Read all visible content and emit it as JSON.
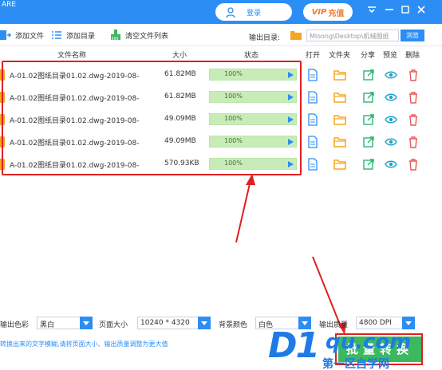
{
  "titlebar": {
    "app_mark": "ARE",
    "login_label": "登录",
    "vip_tag": "VIP",
    "vip_label": "充值",
    "menu_icon": "menu-dropdown-icon",
    "minimize_icon": "minimize-icon",
    "close_icon": "close-icon"
  },
  "toolbar": {
    "add_file": "添加文件",
    "add_dir": "添加目录",
    "clear_list": "清空文件列表",
    "output_dir_label": "输出目录:",
    "output_path": "Mloong\\Desktop\\机械图纸",
    "browse": "浏览"
  },
  "columns": {
    "name": "文件名称",
    "size": "大小",
    "status": "状态",
    "open": "打开",
    "folder": "文件夹",
    "share": "分享",
    "preview": "预览",
    "delete": "删除"
  },
  "files": [
    {
      "name": "A-01.02图纸目录01.02.dwg-2019-08-",
      "size": "61.82MB",
      "progress": "100%",
      "progress_value": 1.0
    },
    {
      "name": "A-01.02图纸目录01.02.dwg-2019-08-",
      "size": "61.82MB",
      "progress": "100%",
      "progress_value": 1.0
    },
    {
      "name": "A-01.02图纸目录01.02.dwg-2019-08-",
      "size": "49.09MB",
      "progress": "100%",
      "progress_value": 1.0
    },
    {
      "name": "A-01.02图纸目录01.02.dwg-2019-08-",
      "size": "49.09MB",
      "progress": "100%",
      "progress_value": 1.0
    },
    {
      "name": "A-01.02图纸目录01.02.dwg-2019-08-",
      "size": "570.93KB",
      "progress": "100%",
      "progress_value": 1.0
    }
  ],
  "settings": {
    "color_label": "输出色彩",
    "color_value": "黑白",
    "page_size_label": "页面大小",
    "page_size_value": "10240 * 4320",
    "bg_color_label": "背景颜色",
    "bg_color_value": "白色",
    "quality_label": "输出质量",
    "quality_value": "4800 DPI"
  },
  "hint": "转换出来的文字模糊,请将页面大小、输出质量调整为更大值",
  "convert_label": "批量转换",
  "watermark": {
    "brand": "D1",
    "site": "qu.com",
    "sub": "第一区自学网"
  },
  "colors": {
    "primary": "#2c8ef4",
    "annotation": "#e02020",
    "progress": "#d7f2cc",
    "convert": "#3cb95e",
    "folder": "#f5a623",
    "share": "#2bb673",
    "preview": "#1aa3c9",
    "delete": "#e85a5a"
  }
}
